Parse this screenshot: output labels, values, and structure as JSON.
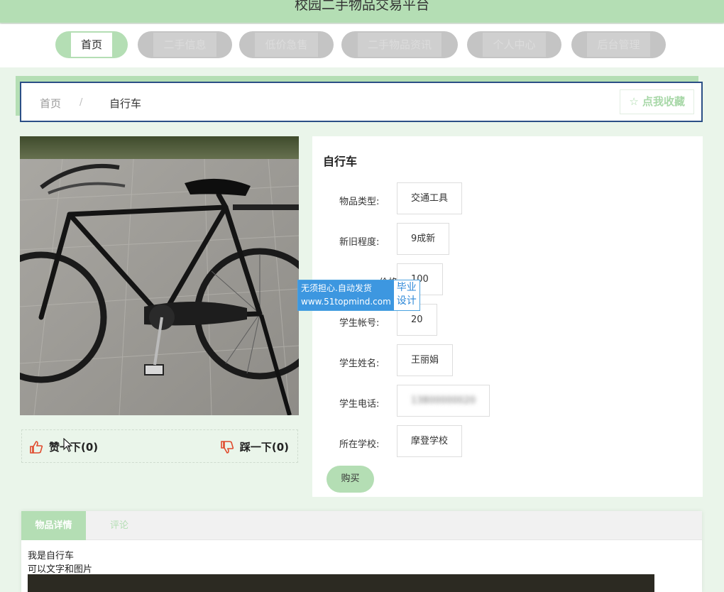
{
  "site": {
    "title": "校园二手物品交易平台"
  },
  "nav": [
    {
      "label": "首页",
      "active": true
    },
    {
      "label": "二手信息",
      "active": false
    },
    {
      "label": "低价急售",
      "active": false
    },
    {
      "label": "二手物品资讯",
      "active": false
    },
    {
      "label": "个人中心",
      "active": false
    },
    {
      "label": "后台管理",
      "active": false
    }
  ],
  "breadcrumb": {
    "home": "首页",
    "separator": "/",
    "current": "自行车"
  },
  "favorite": {
    "icon": "star-outline-icon",
    "label": "☆ 点我收藏"
  },
  "votes": {
    "like_label": "赞一下(0)",
    "like_icon": "thumbs-up-icon",
    "dislike_label": "踩一下(0)",
    "dislike_icon": "thumbs-down-icon"
  },
  "item": {
    "title": "自行车",
    "fields": [
      {
        "label": "物品类型:",
        "value": "交通工具"
      },
      {
        "label": "新旧程度:",
        "value": "9成新"
      },
      {
        "label": "价格:",
        "value": "100"
      },
      {
        "label": "学生帐号:",
        "value": "20"
      },
      {
        "label": "学生姓名:",
        "value": "王丽娟"
      },
      {
        "label": "学生电话:",
        "value": "13800000020"
      },
      {
        "label": "所在学校:",
        "value": "摩登学校"
      }
    ],
    "buy_label": "购买"
  },
  "watermark": {
    "line1": "无须担心.自动发货",
    "line2": "www.51topmind.com",
    "tag1": "毕业",
    "tag2": "设计"
  },
  "tabs": [
    {
      "label": "物品详情",
      "active": true
    },
    {
      "label": "评论",
      "active": false
    }
  ],
  "description": {
    "line1": "我是自行车",
    "line2": "可以文字和图片"
  },
  "colors": {
    "primary_green": "#b4deb4",
    "page_bg": "#eaf5ea",
    "breadcrumb_border": "#2b4f86",
    "vote_icon": "#e04a2c"
  }
}
